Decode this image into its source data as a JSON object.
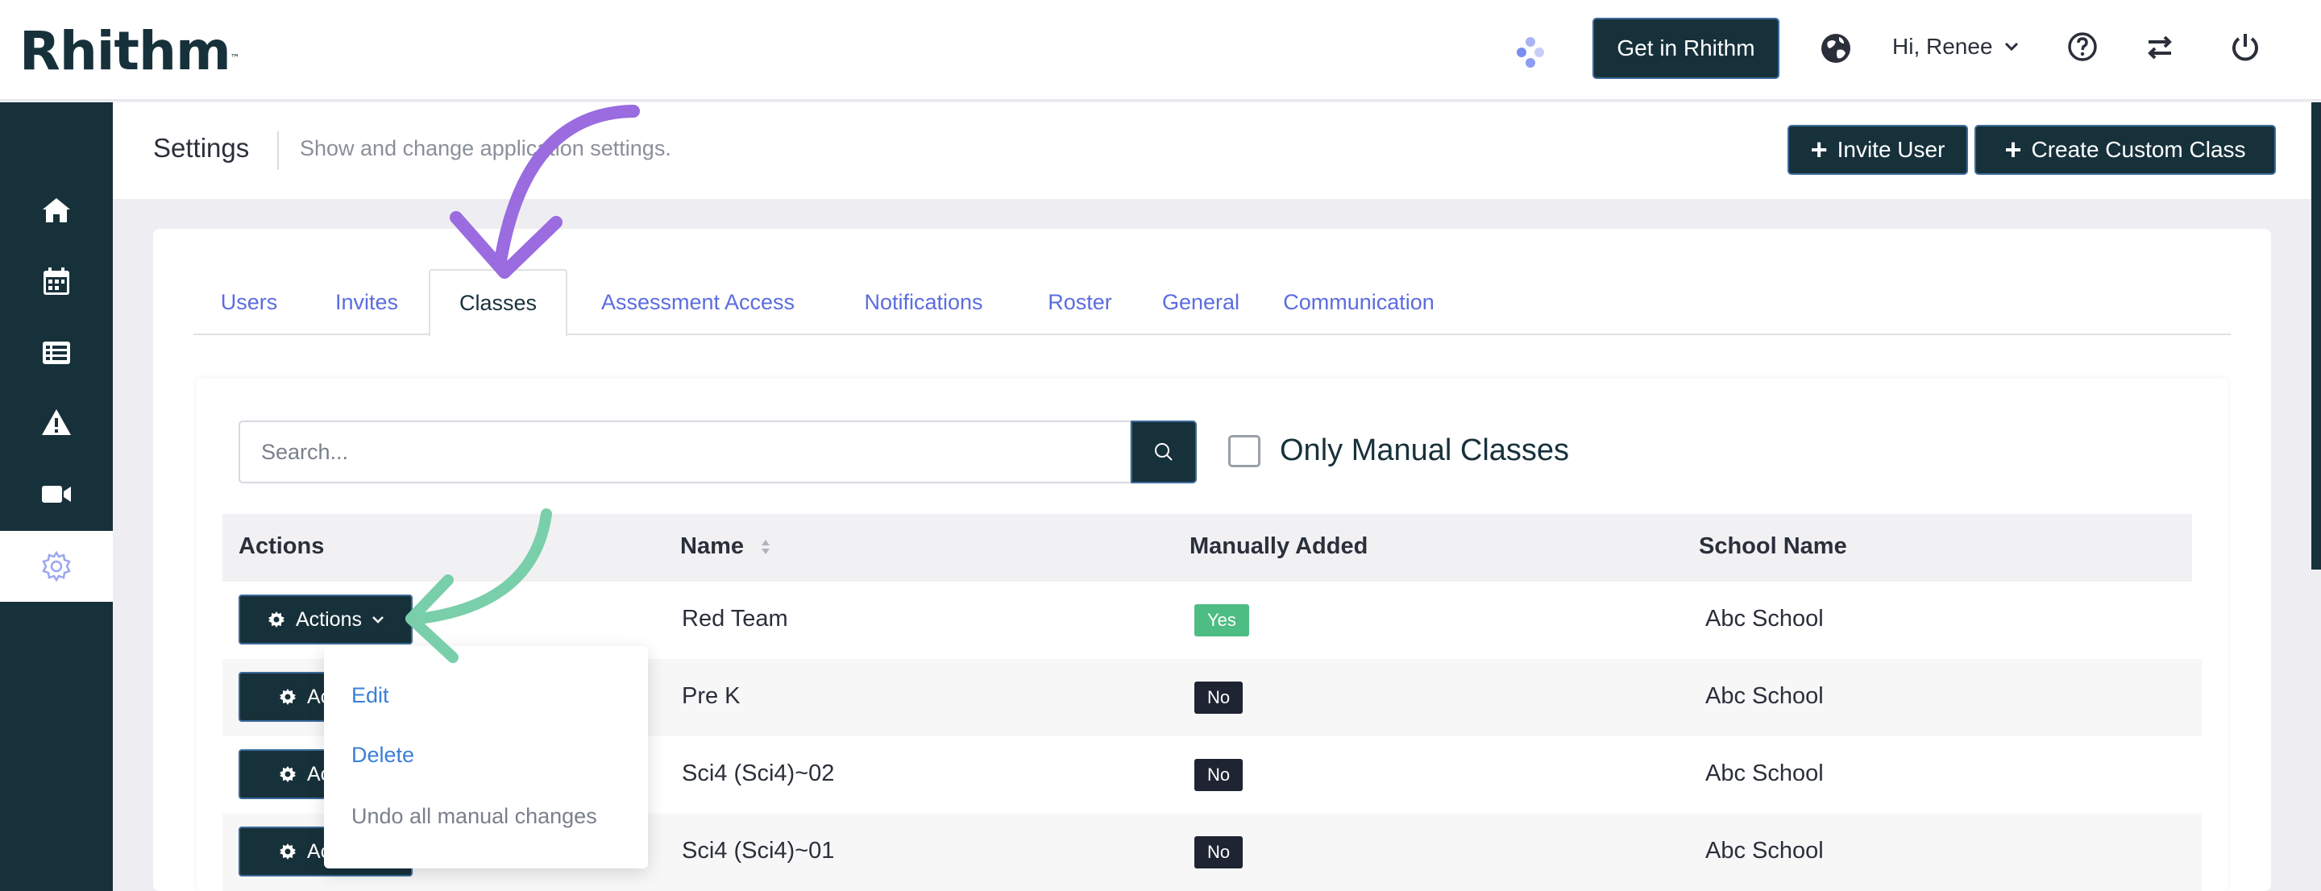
{
  "header": {
    "logo": "Rhithm",
    "logo_tm": "™",
    "get_button": "Get in Rhithm",
    "greeting": "Hi, Renee",
    "icons": [
      "sparkle-icon",
      "globe-icon",
      "help-icon",
      "switch-icon",
      "power-icon"
    ]
  },
  "sidebar": {
    "items": [
      {
        "icon": "home-icon"
      },
      {
        "icon": "calendar-icon"
      },
      {
        "icon": "list-icon"
      },
      {
        "icon": "warning-icon"
      },
      {
        "icon": "video-icon"
      },
      {
        "icon": "gear-icon",
        "active": true
      }
    ]
  },
  "page": {
    "title": "Settings",
    "subtitle": "Show and change application settings.",
    "invite_button": "Invite User",
    "create_button": "Create Custom Class"
  },
  "tabs": [
    {
      "label": "Users"
    },
    {
      "label": "Invites"
    },
    {
      "label": "Classes",
      "active": true
    },
    {
      "label": "Assessment Access"
    },
    {
      "label": "Notifications"
    },
    {
      "label": "Roster"
    },
    {
      "label": "General"
    },
    {
      "label": "Communication"
    }
  ],
  "filters": {
    "search_placeholder": "Search...",
    "search_value": "",
    "only_manual_label": "Only Manual Classes",
    "only_manual_checked": false
  },
  "table": {
    "columns": [
      "Actions",
      "Name",
      "Manually Added",
      "School Name"
    ],
    "rows": [
      {
        "action": "Actions",
        "name": "Red Team",
        "manual": "Yes",
        "school": "Abc School"
      },
      {
        "action": "Actions",
        "name": "Pre K",
        "manual": "No",
        "school": "Abc School"
      },
      {
        "action": "Actions",
        "name": "Sci4 (Sci4)~02",
        "manual": "No",
        "school": "Abc School"
      },
      {
        "action": "Actions",
        "name": "Sci4 (Sci4)~01",
        "manual": "No",
        "school": "Abc School"
      }
    ]
  },
  "dropdown": {
    "items": [
      "Edit",
      "Delete",
      "Undo all manual changes"
    ]
  },
  "colors": {
    "brand_dark": "#17313b",
    "link": "#5b6ce0",
    "yes_badge": "#4ebd83",
    "no_badge": "#1f2433",
    "purple_arrow": "#9b6be0",
    "green_arrow": "#79cfa9"
  }
}
